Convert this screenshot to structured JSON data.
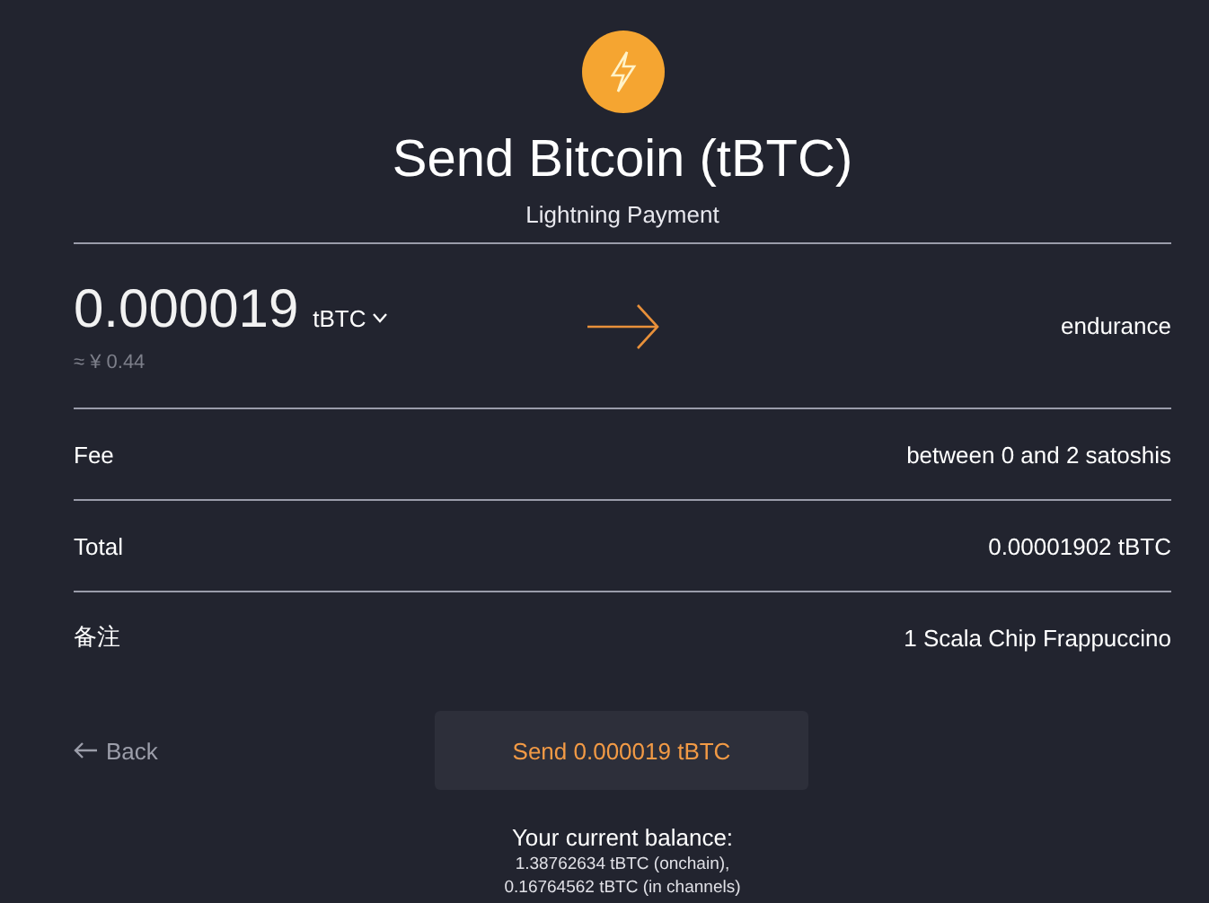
{
  "header": {
    "title": "Send Bitcoin (tBTC)",
    "subtitle": "Lightning Payment"
  },
  "amount": {
    "value": "0.000019",
    "unit": "tBTC",
    "fiat": "≈ ¥ 0.44",
    "destination": "endurance"
  },
  "details": [
    {
      "label": "Fee",
      "value": "between 0 and 2 satoshis"
    },
    {
      "label": "Total",
      "value": "0.00001902 tBTC"
    },
    {
      "label": "备注",
      "value": "1 Scala Chip Frappuccino"
    }
  ],
  "actions": {
    "back": "Back",
    "send": "Send 0.000019 tBTC"
  },
  "balance": {
    "title": "Your current balance:",
    "lines": [
      "1.38762634 tBTC (onchain),",
      "0.16764562 tBTC (in channels)"
    ]
  }
}
